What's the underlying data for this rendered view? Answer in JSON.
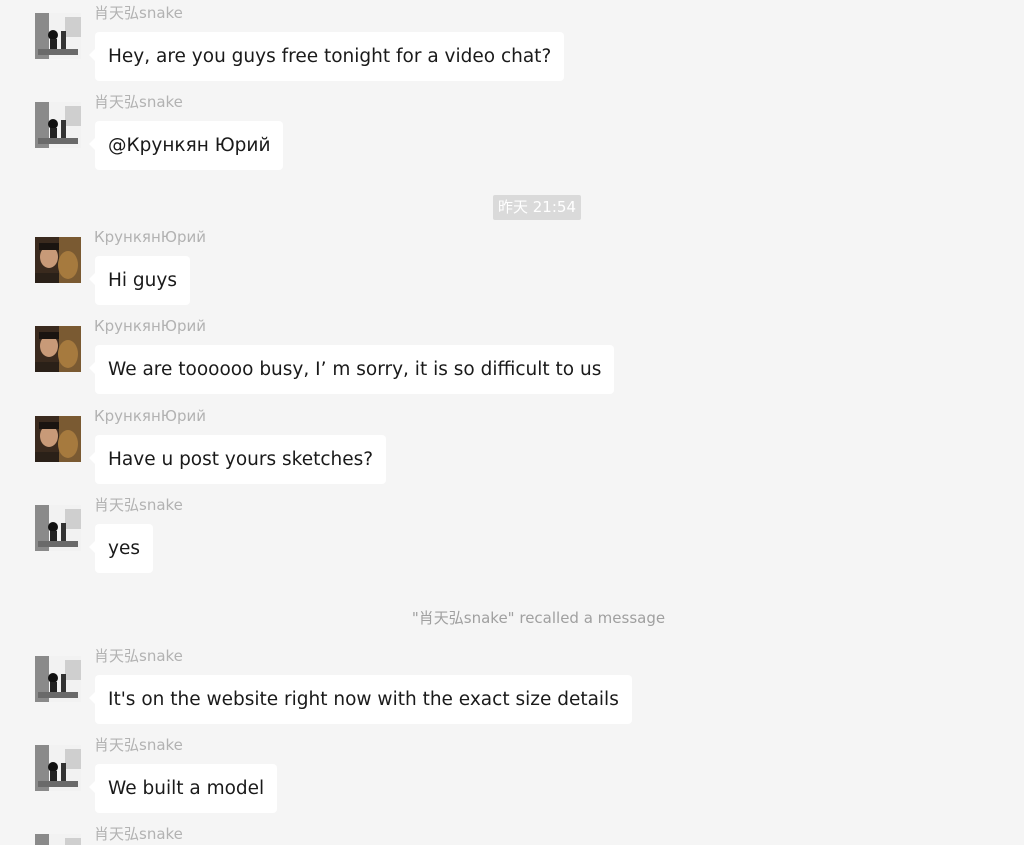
{
  "timestamp": "昨天 21:54",
  "system_notice": "\"肖天弘snake\" recalled a message",
  "messages": [
    {
      "sender": "肖天弘snake",
      "text": "Hey, are you guys free tonight for a video chat?",
      "avatar": "snake-avatar"
    },
    {
      "sender": "肖天弘snake",
      "text": "@Крункян Юрий",
      "avatar": "snake-avatar"
    },
    {
      "sender": "КрункянЮрий",
      "text": "Hi guys",
      "avatar": "yuri-avatar"
    },
    {
      "sender": "КрункянЮрий",
      "text": "We are toooooo busy, I’  m sorry, it is so difficult to us",
      "avatar": "yuri-avatar"
    },
    {
      "sender": "КрункянЮрий",
      "text": "Have u post yours sketches?",
      "avatar": "yuri-avatar"
    },
    {
      "sender": "肖天弘snake",
      "text": "yes",
      "avatar": "snake-avatar"
    },
    {
      "sender": "肖天弘snake",
      "text": "It's on the website right now with the exact size details",
      "avatar": "snake-avatar"
    },
    {
      "sender": "肖天弘snake",
      "text": "We built a model",
      "avatar": "snake-avatar"
    },
    {
      "sender": "肖天弘snake",
      "text": "",
      "avatar": "snake-avatar"
    }
  ]
}
